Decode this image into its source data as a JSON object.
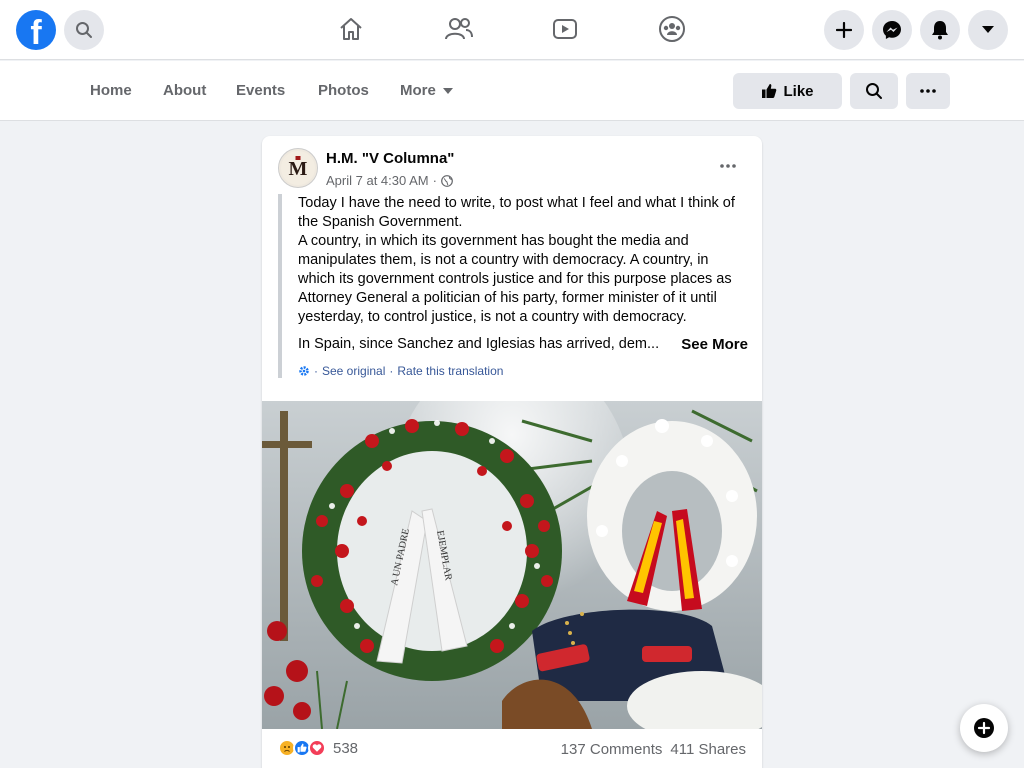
{
  "topbar": {
    "logo_letter": "f",
    "icons": [
      "search-icon",
      "home-icon",
      "friends-icon",
      "watch-icon",
      "groups-icon",
      "create-icon",
      "messenger-icon",
      "notifications-icon",
      "account-menu-icon"
    ]
  },
  "subnav": {
    "items": [
      "Home",
      "About",
      "Events",
      "Photos",
      "More"
    ],
    "like_label": "Like"
  },
  "post": {
    "author": "H.M. \"V Columna\"",
    "date": "April 7 at 4:30 AM",
    "separator": "·",
    "paragraph1": "Today I have the need to write, to post what I feel and what I think of the Spanish Government.",
    "paragraph2": "A country, in which its government has bought the media and manipulates them, is not a country with democracy. A country, in which its government controls justice and for this purpose places as Attorney General a politician of his party, former minister of it until yesterday, to control justice, is not a country with democracy.",
    "paragraph3": "In Spain, since Sanchez and Iglesias has arrived, dem...",
    "see_more": "See More",
    "see_original": "See original",
    "rate_translation": "Rate this translation",
    "ribbon_left": "A UN PADRE",
    "ribbon_right": "EJEMPLAR",
    "reaction_count": "538",
    "comments": "137 Comments",
    "shares": "411 Shares"
  },
  "colors": {
    "brand": "#1877f2",
    "background": "#f0f2f5",
    "link": "#385898"
  }
}
